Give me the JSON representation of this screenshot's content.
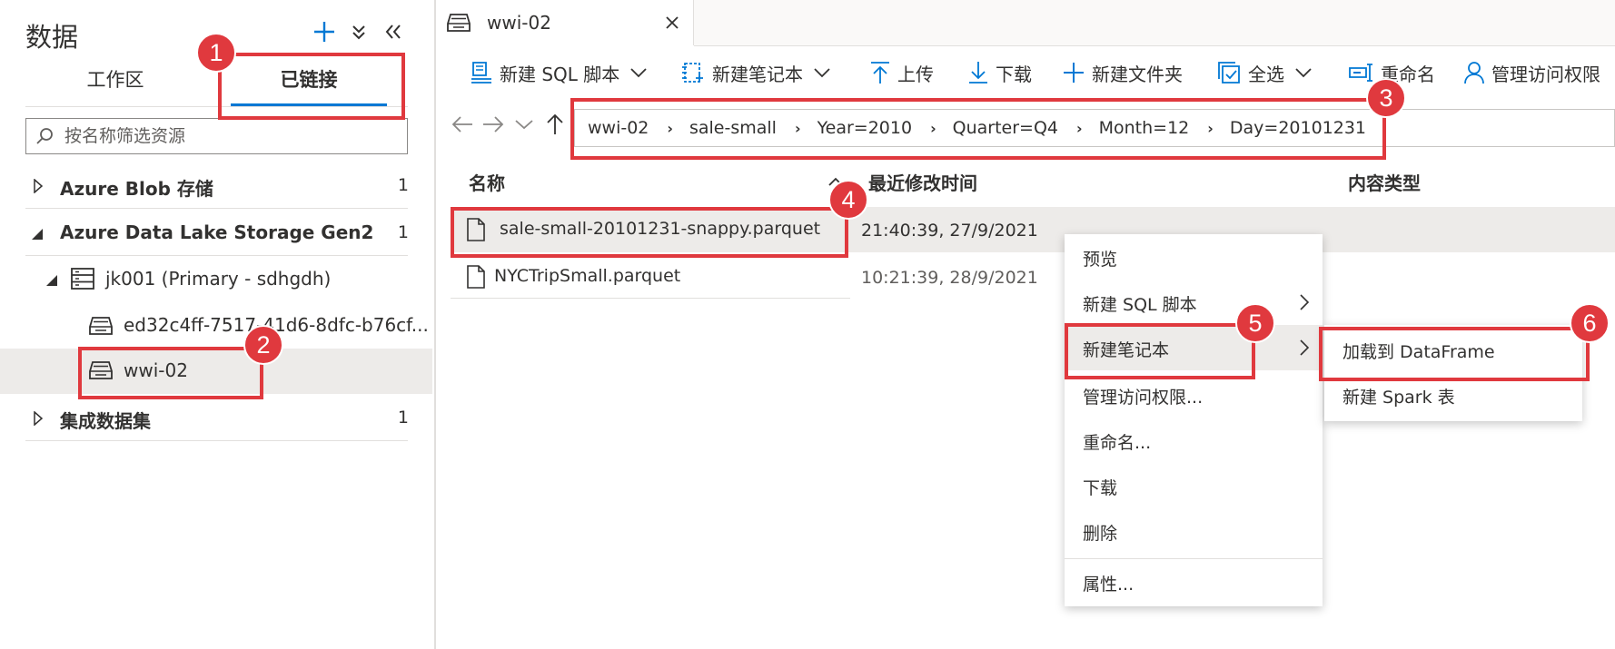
{
  "left_panel": {
    "title": "数据",
    "tabs": [
      {
        "label": "工作区",
        "active": false
      },
      {
        "label": "已链接",
        "active": true
      }
    ],
    "search_placeholder": "按名称筛选资源",
    "tree": {
      "blob": {
        "label": "Azure Blob 存储",
        "count": "1"
      },
      "adls": {
        "label": "Azure Data Lake Storage Gen2",
        "count": "1"
      },
      "account": {
        "label": "jk001 (Primary - sdhgdh)"
      },
      "container1": {
        "label": "ed32c4ff-7517-41d6-8dfc-b76cf..."
      },
      "container2": {
        "label": "wwi-02"
      },
      "integration": {
        "label": "集成数据集",
        "count": "1"
      }
    }
  },
  "file_tab": {
    "label": "wwi-02"
  },
  "toolbar": {
    "new_sql_script": "新建 SQL 脚本",
    "new_notebook": "新建笔记本",
    "upload": "上传",
    "download": "下载",
    "new_folder": "新建文件夹",
    "select_all": "全选",
    "rename": "重命名",
    "manage_access": "管理访问权限"
  },
  "breadcrumb": [
    "wwi-02",
    "sale-small",
    "Year=2010",
    "Quarter=Q4",
    "Month=12",
    "Day=20101231"
  ],
  "columns": {
    "name": "名称",
    "modified": "最近修改时间",
    "content_type": "内容类型"
  },
  "files": [
    {
      "name": "sale-small-20101231-snappy.parquet",
      "modified": "21:40:39, 27/9/2021"
    },
    {
      "name": "NYCTripSmall.parquet",
      "modified": "10:21:39, 28/9/2021"
    }
  ],
  "context_menu": {
    "preview": "预览",
    "new_sql_script": "新建 SQL 脚本",
    "new_notebook": "新建笔记本",
    "manage_access": "管理访问权限...",
    "rename": "重命名...",
    "download": "下载",
    "delete": "删除",
    "properties": "属性..."
  },
  "submenu": {
    "load_dataframe": "加载到 DataFrame",
    "new_spark_table": "新建 Spark 表"
  },
  "callouts": [
    "1",
    "2",
    "3",
    "4",
    "5",
    "6"
  ],
  "colors": {
    "accent": "#0078d4",
    "callout": "#e0393e",
    "selected_bg": "#edebe9"
  }
}
